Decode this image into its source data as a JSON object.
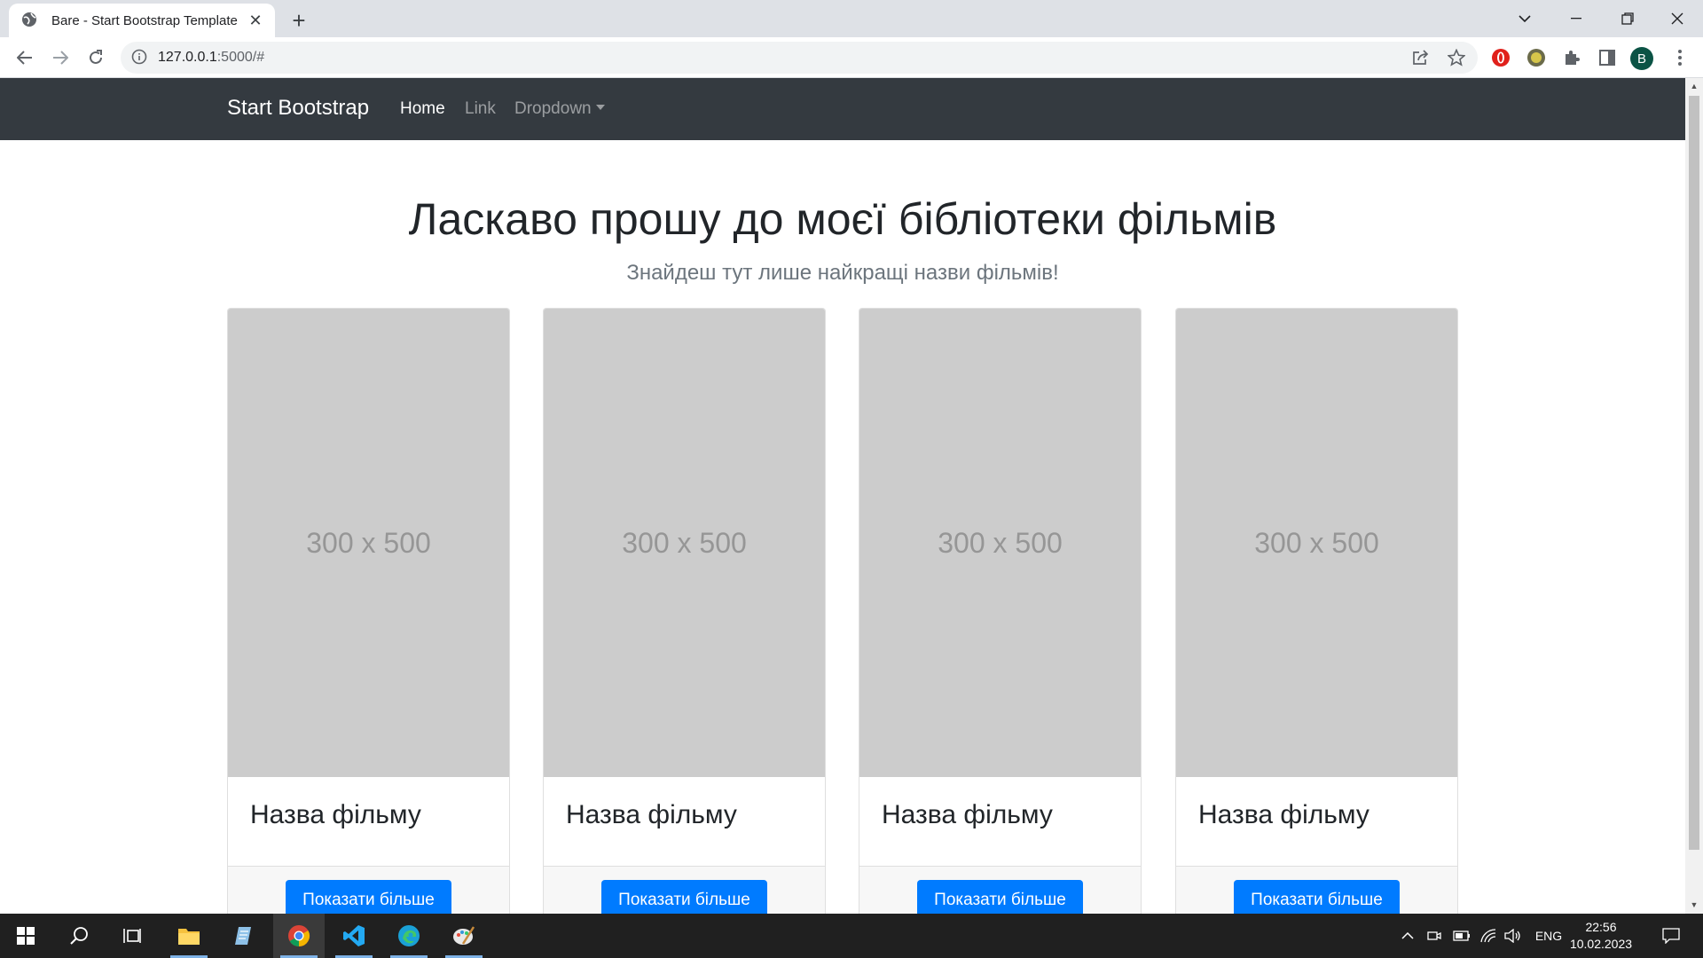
{
  "browser": {
    "tab_title": "Bare - Start Bootstrap Template",
    "url_host": "127.0.0.1",
    "url_rest": ":5000/#",
    "profile_initial": "B"
  },
  "navbar": {
    "brand": "Start Bootstrap",
    "links": [
      {
        "label": "Home",
        "active": true
      },
      {
        "label": "Link",
        "active": false
      },
      {
        "label": "Dropdown",
        "active": false
      }
    ]
  },
  "hero": {
    "title": "Ласкаво прошу до моєї бібліотеки фільмів",
    "subtitle": "Знайдеш тут лише найкращі назви фільмів!"
  },
  "cards": [
    {
      "image_placeholder": "300 x 500",
      "title": "Назва фільму",
      "button": "Показати більше"
    },
    {
      "image_placeholder": "300 x 500",
      "title": "Назва фільму",
      "button": "Показати більше"
    },
    {
      "image_placeholder": "300 x 500",
      "title": "Назва фільму",
      "button": "Показати більше"
    },
    {
      "image_placeholder": "300 x 500",
      "title": "Назва фільму",
      "button": "Показати більше"
    }
  ],
  "taskbar": {
    "language": "ENG",
    "time": "22:56",
    "date": "10.02.2023",
    "pinned_apps": [
      "start",
      "search",
      "task-view",
      "file-explorer",
      "notepad",
      "chrome",
      "vscode",
      "edge",
      "paint"
    ]
  },
  "colors": {
    "navbar_bg": "#343a40",
    "primary_button": "#007bff",
    "placeholder_bg": "#cccccc"
  }
}
